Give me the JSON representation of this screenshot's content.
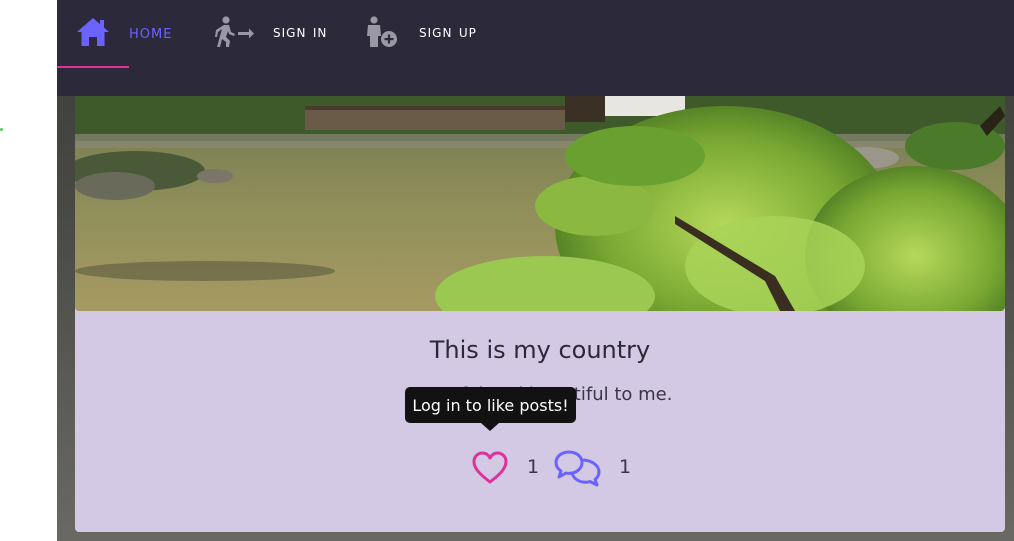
{
  "colors": {
    "nav_bg": "#2c2a3a",
    "accent": "#6b63ff",
    "underline": "#e0309a",
    "card_bg": "#d3c9e4",
    "heart": "#e0309a",
    "comment": "#6b63ff"
  },
  "nav": {
    "items": [
      {
        "label": "Home",
        "icon": "home-icon"
      },
      {
        "label": "Sign in",
        "icon": "sign-in-walk-icon"
      },
      {
        "label": "Sign up",
        "icon": "add-user-icon"
      }
    ]
  },
  "post": {
    "image_alt": "garden pond",
    "title": "This is my country",
    "text": "Peaceful and beautiful to me.",
    "likes": "1",
    "comments": "1"
  },
  "tooltip": {
    "text": "Log in to like posts!"
  }
}
